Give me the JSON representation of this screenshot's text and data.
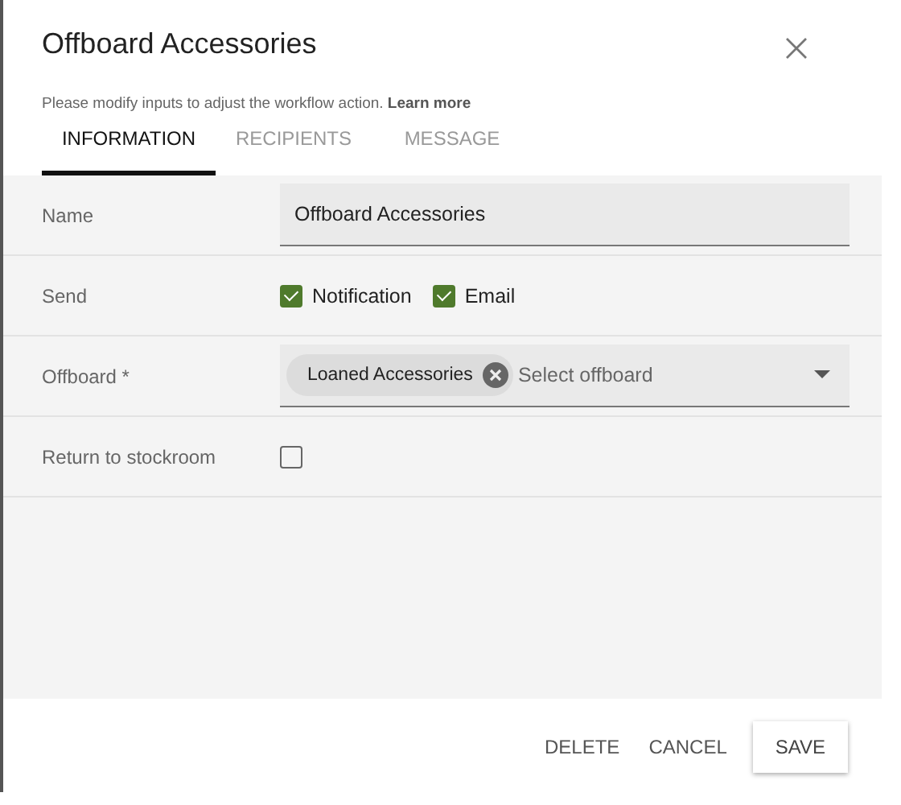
{
  "dialog": {
    "title": "Offboard Accessories",
    "subtitle": "Please modify inputs to adjust the workflow action.",
    "learn_more": "Learn more"
  },
  "tabs": [
    {
      "label": "INFORMATION",
      "selected": true
    },
    {
      "label": "RECIPIENTS",
      "selected": false
    },
    {
      "label": "MESSAGE",
      "selected": false
    }
  ],
  "fields": [
    {
      "kind": "text",
      "label": "Name",
      "value": "Offboard Accessories"
    },
    {
      "kind": "checkboxes",
      "label": "Send",
      "options": [
        {
          "label": "Notification",
          "checked": true
        },
        {
          "label": "Email",
          "checked": true
        }
      ]
    },
    {
      "kind": "select",
      "label": "Offboard *",
      "chips": [
        "Loaned Accessories"
      ],
      "placeholder": "Select offboard"
    },
    {
      "kind": "checkbox",
      "label": "Return to stockroom",
      "checked": false
    }
  ],
  "buttons": [
    {
      "label": "DELETE",
      "kind": "flat"
    },
    {
      "label": "CANCEL",
      "kind": "flat"
    },
    {
      "label": "SAVE",
      "kind": "raised"
    }
  ]
}
